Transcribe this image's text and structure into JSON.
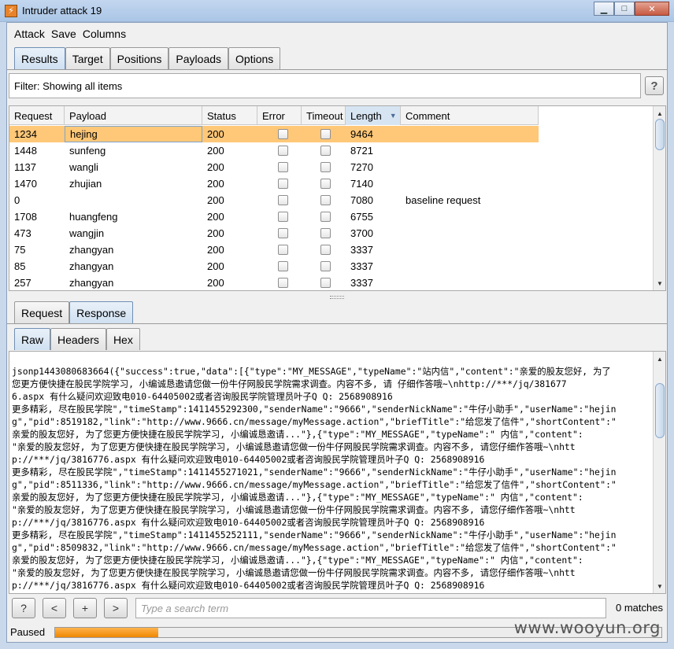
{
  "window": {
    "title": "Intruder attack 19",
    "app_icon": "burp-lightning-icon"
  },
  "menu": [
    "Attack",
    "Save",
    "Columns"
  ],
  "main_tabs": [
    "Results",
    "Target",
    "Positions",
    "Payloads",
    "Options"
  ],
  "filter": {
    "text": "Filter: Showing all items",
    "help_label": "?"
  },
  "table": {
    "columns": [
      "Request",
      "Payload",
      "Status",
      "Error",
      "Timeout",
      "Length",
      "Comment"
    ],
    "sorted_column": "Length",
    "rows": [
      {
        "request": "1234",
        "payload": "hejing",
        "status": "200",
        "error": false,
        "timeout": false,
        "length": "9464",
        "comment": "",
        "selected": true
      },
      {
        "request": "1448",
        "payload": "sunfeng",
        "status": "200",
        "error": false,
        "timeout": false,
        "length": "8721",
        "comment": ""
      },
      {
        "request": "1137",
        "payload": "wangli",
        "status": "200",
        "error": false,
        "timeout": false,
        "length": "7270",
        "comment": ""
      },
      {
        "request": "1470",
        "payload": "zhujian",
        "status": "200",
        "error": false,
        "timeout": false,
        "length": "7140",
        "comment": ""
      },
      {
        "request": "0",
        "payload": "",
        "status": "200",
        "error": false,
        "timeout": false,
        "length": "7080",
        "comment": "baseline request"
      },
      {
        "request": "1708",
        "payload": "huangfeng",
        "status": "200",
        "error": false,
        "timeout": false,
        "length": "6755",
        "comment": ""
      },
      {
        "request": "473",
        "payload": "wangjin",
        "status": "200",
        "error": false,
        "timeout": false,
        "length": "3700",
        "comment": ""
      },
      {
        "request": "75",
        "payload": "zhangyan",
        "status": "200",
        "error": false,
        "timeout": false,
        "length": "3337",
        "comment": ""
      },
      {
        "request": "85",
        "payload": "zhangyan",
        "status": "200",
        "error": false,
        "timeout": false,
        "length": "3337",
        "comment": ""
      },
      {
        "request": "257",
        "payload": "zhangyan",
        "status": "200",
        "error": false,
        "timeout": false,
        "length": "3337",
        "comment": ""
      }
    ]
  },
  "detail_tabs": [
    "Request",
    "Response"
  ],
  "view_tabs": [
    "Raw",
    "Headers",
    "Hex"
  ],
  "raw_lines": [
    "jsonp1443080683664({\"success\":true,\"data\":[{\"type\":\"MY_MESSAGE\",\"typeName\":\"站内信\",\"content\":\"亲爱的股友您好, 为了",
    "您更方便快捷在股民学院学习, 小编诚恳邀请您做一份牛仔网股民学院需求调查。内容不多, 请   仔细作答哦~\\nhttp://***/jq/381677",
    "6.aspx  有什么疑问欢迎致电010-64405002或者咨询股民学院管理员叶子Q  Q: 2568908916",
    "更多精彩, 尽在股民学院\",\"timeStamp\":1411455292300,\"senderName\":\"9666\",\"senderNickName\":\"牛仔小助手\",\"userName\":\"hejin",
    "g\",\"pid\":8519182,\"link\":\"http://www.9666.cn/message/myMessage.action\",\"briefTitle\":\"给您发了信件\",\"shortContent\":\"",
    "亲爱的股友您好, 为了您更方便快捷在股民学院学习, 小编诚恳邀请...\"},{\"type\":\"MY_MESSAGE\",\"typeName\":\"   内信\",\"content\":",
    "\"亲爱的股友您好, 为了您更方便快捷在股民学院学习, 小编诚恳邀请您做一份牛仔网股民学院需求调查。内容不多, 请您仔细作答哦~\\nhtt",
    "p://***/jq/3816776.aspx  有什么疑问欢迎致电010-64405002或者咨询股民学院管理员叶子Q  Q: 2568908916",
    "更多精彩, 尽在股民学院\",\"timeStamp\":1411455271021,\"senderName\":\"9666\",\"senderNickName\":\"牛仔小助手\",\"userName\":\"hejin",
    "g\",\"pid\":8511336,\"link\":\"http://www.9666.cn/message/myMessage.action\",\"briefTitle\":\"给您发了信件\",\"shortContent\":\"",
    "亲爱的股友您好, 为了您更方便快捷在股民学院学习, 小编诚恳邀请...\"},{\"type\":\"MY_MESSAGE\",\"typeName\":\"   内信\",\"content\":",
    "\"亲爱的股友您好, 为了您更方便快捷在股民学院学习, 小编诚恳邀请您做一份牛仔网股民学院需求调查。内容不多, 请您仔细作答哦~\\nhtt",
    "p://***/jq/3816776.aspx  有什么疑问欢迎致电010-64405002或者咨询股民学院管理员叶子Q  Q: 2568908916",
    "更多精彩, 尽在股民学院\",\"timeStamp\":1411455252111,\"senderName\":\"9666\",\"senderNickName\":\"牛仔小助手\",\"userName\":\"hejin",
    "g\",\"pid\":8509832,\"link\":\"http://www.9666.cn/message/myMessage.action\",\"briefTitle\":\"给您发了信件\",\"shortContent\":\"",
    "亲爱的股友您好, 为了您更方便快捷在股民学院学习, 小编诚恳邀请...\"},{\"type\":\"MY_MESSAGE\",\"typeName\":\"   内信\",\"content\":",
    "\"亲爱的股友您好, 为了您更方便快捷在股民学院学习, 小编诚恳邀请您做一份牛仔网股民学院需求调查。内容不多, 请您仔细作答哦~\\nhtt",
    "p://***/jq/3816776.aspx  有什么疑问欢迎致电010-64405002或者咨询股民学院管理员叶子Q  Q: 2568908916"
  ],
  "search": {
    "help_label": "?",
    "prev_label": "<",
    "add_label": "+",
    "next_label": ">",
    "placeholder": "Type a search term",
    "matches": "0 matches"
  },
  "status": {
    "label": "Paused",
    "progress": 0.17
  },
  "watermark": "www.wooyun.org",
  "colors": {
    "selected_row": "#ffc878",
    "progress": "#ef8700"
  }
}
